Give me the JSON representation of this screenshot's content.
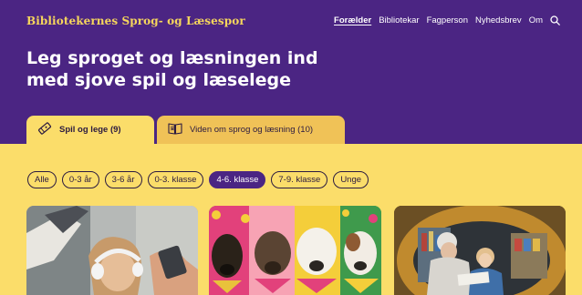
{
  "site": {
    "brand": "Bibliotekernes Sprog- og Læsespor"
  },
  "nav": {
    "items": [
      {
        "label": "Forælder",
        "active": true
      },
      {
        "label": "Bibliotekar",
        "active": false
      },
      {
        "label": "Fagperson",
        "active": false
      },
      {
        "label": "Nyhedsbrev",
        "active": false
      },
      {
        "label": "Om",
        "active": false
      }
    ],
    "search_icon": "search-icon"
  },
  "hero": {
    "line1": "Leg sproget og læsningen ind",
    "line2": "med sjove spil og læselege"
  },
  "tabs": [
    {
      "label": "Spil og lege (9)",
      "icon": "tag-icon",
      "active": true
    },
    {
      "label": "Viden om sprog og læsning (10)",
      "icon": "book-icon",
      "active": false
    }
  ],
  "filters": [
    {
      "label": "Alle",
      "active": false
    },
    {
      "label": "0-3 år",
      "active": false
    },
    {
      "label": "3-6 år",
      "active": false
    },
    {
      "label": "0-3. klasse",
      "active": false
    },
    {
      "label": "4-6. klasse",
      "active": true
    },
    {
      "label": "7-9. klasse",
      "active": false
    },
    {
      "label": "Unge",
      "active": false
    }
  ],
  "colors": {
    "purple": "#4b2583",
    "yellow": "#fbdd6a",
    "tab_inactive": "#f0c257",
    "brand_text": "#f6d65c",
    "dark_text": "#2b1a40"
  }
}
